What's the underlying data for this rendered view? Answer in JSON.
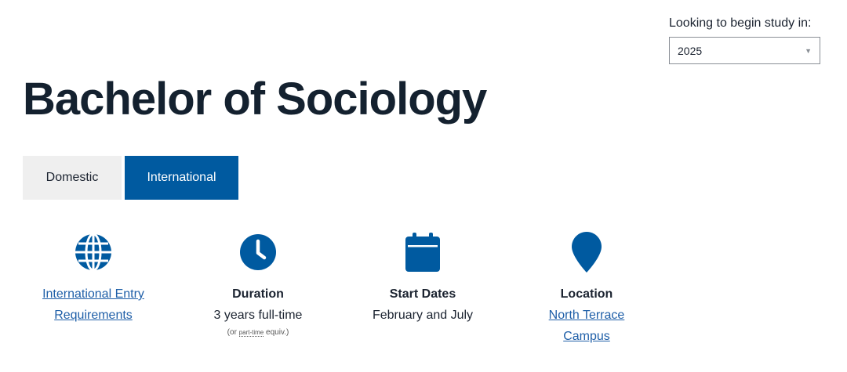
{
  "intake": {
    "label": "Looking to begin study in:",
    "selected_year": "2025"
  },
  "page": {
    "title": "Bachelor of Sociology"
  },
  "tabs": [
    {
      "label": "Domestic",
      "active": false
    },
    {
      "label": "International",
      "active": true
    }
  ],
  "facts": {
    "entry": {
      "icon": "globe-icon",
      "link_line1": "International Entry",
      "link_line2": "Requirements"
    },
    "duration": {
      "icon": "clock-icon",
      "heading": "Duration",
      "value": "3 years full-time",
      "note_prefix": "(or",
      "note_abbr": "part-time",
      "note_suffix": "equiv.)"
    },
    "start": {
      "icon": "calendar-icon",
      "heading": "Start Dates",
      "value": "February and July"
    },
    "location": {
      "icon": "map-pin-icon",
      "heading": "Location",
      "link_line1": "North Terrace",
      "link_line2": "Campus"
    }
  },
  "colors": {
    "brand_blue": "#005aa0",
    "link_blue": "#1f5fa8",
    "title_dark": "#14212f"
  }
}
